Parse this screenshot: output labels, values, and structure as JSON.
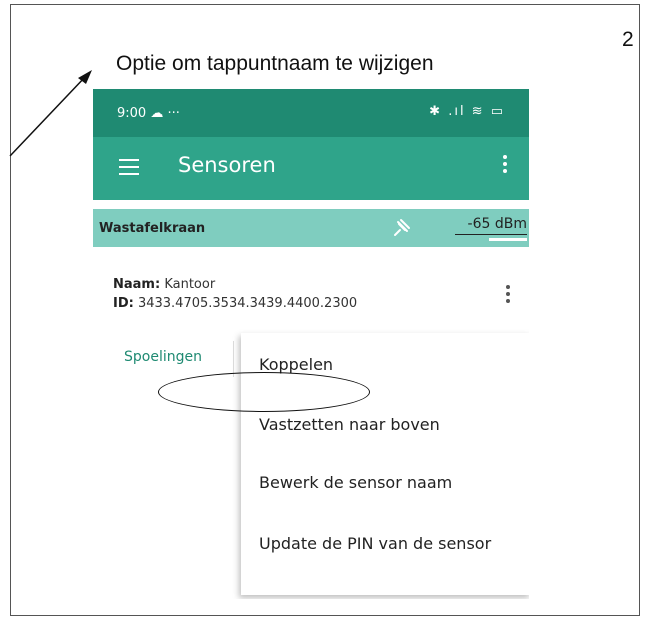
{
  "page_number": "2",
  "caption": "Optie om tappuntnaam te wijzigen",
  "status_bar": {
    "time": "9:00",
    "right_icons": "bluetooth signal wifi battery",
    "battery": "84"
  },
  "app_bar": {
    "title": "Sensoren"
  },
  "sensor": {
    "name": "Wastafelkraan",
    "signal": "-65 dBm",
    "name_label": "Naam:",
    "name_value": "Kantoor",
    "id_label": "ID:",
    "id_value": "3433.4705.3534.3439.4400.2300"
  },
  "tab": {
    "label": "Spoelingen"
  },
  "menu": {
    "items": [
      "Koppelen",
      "Vastzetten naar boven",
      "Bewerk de sensor naam",
      "Update de PIN van de sensor"
    ]
  },
  "colors": {
    "status_bar": "#1f8a72",
    "app_bar": "#2fa48a",
    "sensor_bar": "#7fcdbf",
    "accent": "#1f8a72"
  }
}
